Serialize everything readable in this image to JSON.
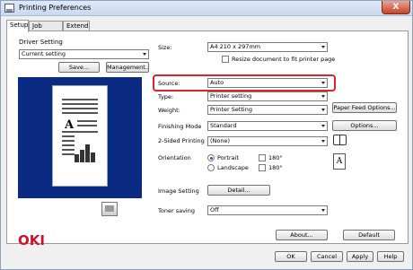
{
  "window": {
    "title": "Printing Preferences",
    "close_label": "X"
  },
  "tabs": [
    {
      "label": "Setup",
      "active": true
    },
    {
      "label": "Job Options",
      "active": false
    },
    {
      "label": "Extend",
      "active": false
    }
  ],
  "driver_setting": {
    "group_label": "Driver Setting",
    "combo_value": "Current setting",
    "save_label": "Save...",
    "management_label": "Management..."
  },
  "size": {
    "label": "Size:",
    "value": "A4 210 x 297mm",
    "resize_label": "Resize document to fit printer page"
  },
  "source": {
    "label": "Source:",
    "value": "Auto"
  },
  "type": {
    "label": "Type:",
    "value": "Printer setting"
  },
  "weight": {
    "label": "Weight:",
    "value": "Printer Setting",
    "button": "Paper Feed Options..."
  },
  "finishing_mode": {
    "label": "Finishing Mode",
    "value": "Standard",
    "button": "Options..."
  },
  "two_sided": {
    "label": "2-Sided Printing",
    "value": "(None)"
  },
  "orientation": {
    "label": "Orientation",
    "portrait": "Portrait",
    "landscape": "Landscape",
    "rotate_180_a": "180°",
    "rotate_180_b": "180°",
    "preview_glyph": "A"
  },
  "image_setting": {
    "label": "Image Setting",
    "button": "Detail..."
  },
  "toner_saving": {
    "label": "Toner saving",
    "value": "Off"
  },
  "preview": {
    "glyph": "A"
  },
  "brand": {
    "logo": "OKI",
    "color": "#d0102b"
  },
  "footer": {
    "about": "About...",
    "default": "Default",
    "ok": "OK",
    "cancel": "Cancel",
    "apply": "Apply",
    "help": "Help"
  },
  "colors": {
    "highlight": "#d8262b",
    "preview_bg": "#0b2a82"
  }
}
